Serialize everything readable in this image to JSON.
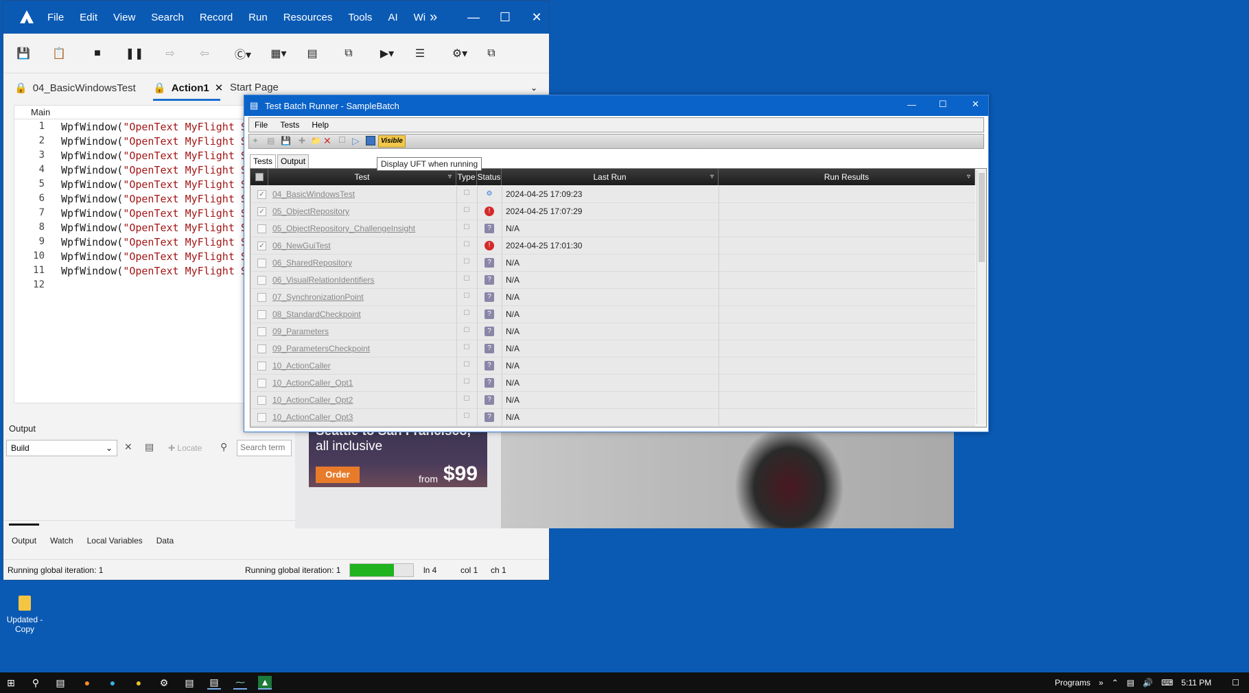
{
  "uft": {
    "menu": [
      "File",
      "Edit",
      "View",
      "Search",
      "Record",
      "Run",
      "Resources",
      "Tools",
      "AI",
      "Wi"
    ],
    "overflow_glyph": "»",
    "tabs": {
      "test": "04_BasicWindowsTest",
      "action": "Action1",
      "start": "Start Page"
    },
    "editor": {
      "header": "Main",
      "lines": [
        "1",
        "2",
        "3",
        "4",
        "5",
        "6",
        "7",
        "8",
        "9",
        "10",
        "11",
        "12"
      ],
      "code_prefix": "WpfWindow(",
      "code_string": "\"OpenText MyFlight Samp"
    },
    "output": {
      "title": "Output",
      "filter": "Build",
      "locate": "Locate",
      "search_placeholder": "Search term",
      "bottom_tabs": [
        "Output",
        "Watch",
        "Local Variables",
        "Data"
      ]
    },
    "status": {
      "left": "Running global iteration: 1",
      "mid": "Running global iteration: 1",
      "progress": 0.7,
      "ln": "ln 4",
      "col": "col 1",
      "ch": "ch 1"
    }
  },
  "ad": {
    "line1": "Seattle to San Francisco,",
    "line2": "all inclusive",
    "order": "Order",
    "from": "from",
    "price": "$99"
  },
  "batch_runner": {
    "title": "Test Batch Runner - SampleBatch",
    "menu": [
      "File",
      "Tests",
      "Help"
    ],
    "visible_label": "Visible",
    "tabs": [
      "Tests",
      "Output"
    ],
    "tooltip": "Display UFT when running",
    "columns": [
      "Test",
      "Type",
      "Status",
      "Last Run",
      "Run Results"
    ],
    "rows": [
      {
        "name": "04_BasicWindowsTest",
        "checked": true,
        "status": "running",
        "last_run": "2024-04-25 17:09:23"
      },
      {
        "name": "05_ObjectRepository",
        "checked": true,
        "status": "error",
        "last_run": "2024-04-25 17:07:29"
      },
      {
        "name": "05_ObjectRepository_ChallengeInsight",
        "checked": false,
        "status": "unknown",
        "last_run": "N/A"
      },
      {
        "name": "06_NewGuiTest",
        "checked": true,
        "status": "error",
        "last_run": "2024-04-25 17:01:30"
      },
      {
        "name": "06_SharedRepository",
        "checked": false,
        "status": "unknown",
        "last_run": "N/A"
      },
      {
        "name": "06_VisualRelationIdentifiers",
        "checked": false,
        "status": "unknown",
        "last_run": "N/A"
      },
      {
        "name": "07_SynchronizationPoint",
        "checked": false,
        "status": "unknown",
        "last_run": "N/A"
      },
      {
        "name": "08_StandardCheckpoint",
        "checked": false,
        "status": "unknown",
        "last_run": "N/A"
      },
      {
        "name": "09_Parameters",
        "checked": false,
        "status": "unknown",
        "last_run": "N/A"
      },
      {
        "name": "09_ParametersCheckpoint",
        "checked": false,
        "status": "unknown",
        "last_run": "N/A"
      },
      {
        "name": "10_ActionCaller",
        "checked": false,
        "status": "unknown",
        "last_run": "N/A"
      },
      {
        "name": "10_ActionCaller_Opt1",
        "checked": false,
        "status": "unknown",
        "last_run": "N/A"
      },
      {
        "name": "10_ActionCaller_Opt2",
        "checked": false,
        "status": "unknown",
        "last_run": "N/A"
      },
      {
        "name": "10_ActionCaller_Opt3",
        "checked": false,
        "status": "unknown",
        "last_run": "N/A"
      }
    ]
  },
  "desktop": {
    "icon_label_1": "Updated -",
    "icon_label_2": "Copy"
  },
  "taskbar": {
    "programs": "Programs",
    "time": "5:11 PM"
  },
  "colors": {
    "accent": "#0a5ab4",
    "error": "#d42a2a",
    "progress": "#1fb31f"
  }
}
